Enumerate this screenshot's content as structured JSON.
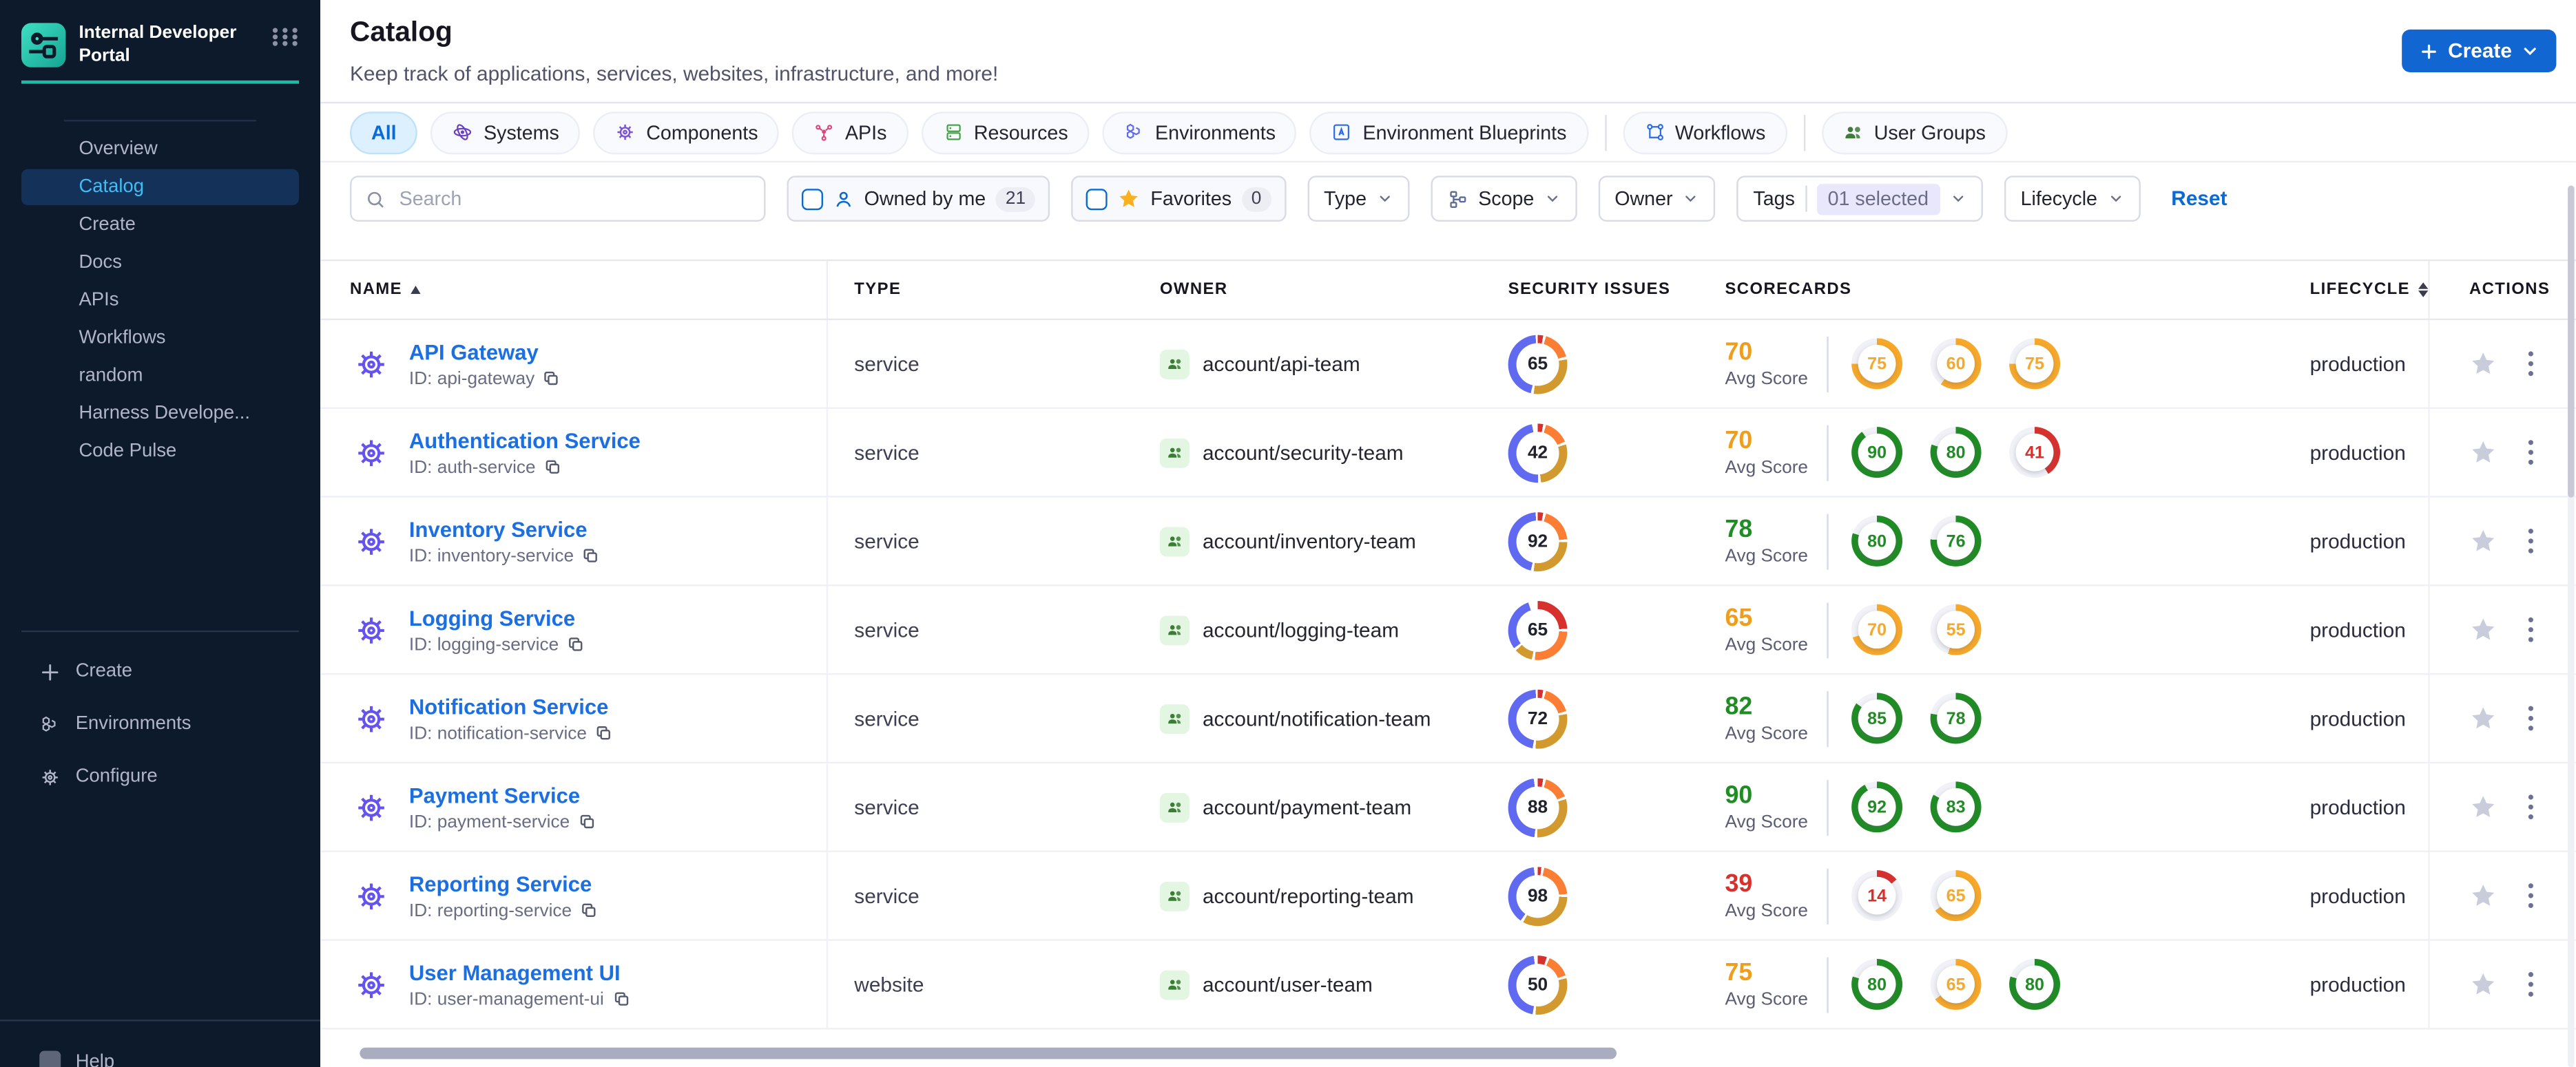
{
  "brand": {
    "title_line1": "Internal Developer",
    "title_line2": "Portal"
  },
  "sidebar": {
    "nav": [
      {
        "label": "Overview",
        "active": false
      },
      {
        "label": "Catalog",
        "active": true
      },
      {
        "label": "Create",
        "active": false
      },
      {
        "label": "Docs",
        "active": false
      },
      {
        "label": "APIs",
        "active": false
      },
      {
        "label": "Workflows",
        "active": false
      },
      {
        "label": "random",
        "active": false
      },
      {
        "label": "Harness Develope...",
        "active": false
      },
      {
        "label": "Code Pulse",
        "active": false
      }
    ],
    "bottom": [
      {
        "label": "Create",
        "icon": "plus"
      },
      {
        "label": "Environments",
        "icon": "hexagons"
      },
      {
        "label": "Configure",
        "icon": "gear"
      }
    ],
    "help_label": "Help"
  },
  "header": {
    "title": "Catalog",
    "subtitle": "Keep track of applications, services, websites, infrastructure, and more!",
    "create_button": "Create"
  },
  "tabs": [
    {
      "label": "All",
      "active": true,
      "icon": "",
      "color": "#0b6ad3",
      "divider_before": false
    },
    {
      "label": "Systems",
      "active": false,
      "icon": "systems",
      "color": "#6b3fc4",
      "divider_before": false
    },
    {
      "label": "Components",
      "active": false,
      "icon": "gear",
      "color": "#7a52d6",
      "divider_before": false
    },
    {
      "label": "APIs",
      "active": false,
      "icon": "apis",
      "color": "#e0447c",
      "divider_before": false
    },
    {
      "label": "Resources",
      "active": false,
      "icon": "resources",
      "color": "#43a047",
      "divider_before": false
    },
    {
      "label": "Environments",
      "active": false,
      "icon": "hexagons",
      "color": "#5f6af0",
      "divider_before": false
    },
    {
      "label": "Environment Blueprints",
      "active": false,
      "icon": "blueprint",
      "color": "#2b6be4",
      "divider_before": false
    },
    {
      "label": "Workflows",
      "active": false,
      "icon": "workflows",
      "color": "#2b6be4",
      "divider_before": true
    },
    {
      "label": "User Groups",
      "active": false,
      "icon": "people",
      "color": "#3e7d3a",
      "divider_before": true
    }
  ],
  "filters": {
    "search_placeholder": "Search",
    "owned_by_me": {
      "label": "Owned by me",
      "count": "21"
    },
    "favorites": {
      "label": "Favorites",
      "count": "0"
    },
    "type_label": "Type",
    "scope_label": "Scope",
    "owner_label": "Owner",
    "tags_label": "Tags",
    "tags_selected": "01 selected",
    "lifecycle_label": "Lifecycle",
    "reset_label": "Reset"
  },
  "table": {
    "columns": {
      "name": "Name",
      "type": "Type",
      "owner": "Owner",
      "security": "Security Issues",
      "scorecards": "Scorecards",
      "lifecycle": "Lifecycle",
      "actions": "Actions"
    },
    "avg_score_label": "Avg Score",
    "rows": [
      {
        "name": "API Gateway",
        "id": "ID: api-gateway",
        "type": "service",
        "owner": "account/api-team",
        "security_issues": "65",
        "donut": [
          [
            "#d7312e",
            3
          ],
          [
            "#fb7e34",
            16
          ],
          [
            "#d1992e",
            30
          ],
          [
            "#5f6af0",
            45
          ]
        ],
        "avg_score": {
          "value": "70",
          "color": "#ee9d1c"
        },
        "scores": [
          {
            "value": "75",
            "color": "#f7a82a"
          },
          {
            "value": "60",
            "color": "#f7a82a"
          },
          {
            "value": "75",
            "color": "#f7a82a"
          }
        ],
        "lifecycle": "production"
      },
      {
        "name": "Authentication Service",
        "id": "ID: auth-service",
        "type": "service",
        "owner": "account/security-team",
        "security_issues": "42",
        "donut": [
          [
            "#d7312e",
            3
          ],
          [
            "#fb7e34",
            14
          ],
          [
            "#d1992e",
            28
          ],
          [
            "#5f6af0",
            47
          ]
        ],
        "avg_score": {
          "value": "70",
          "color": "#ee9d1c"
        },
        "scores": [
          {
            "value": "90",
            "color": "#1f8c24"
          },
          {
            "value": "80",
            "color": "#1f8c24"
          },
          {
            "value": "41",
            "color": "#d7312e"
          }
        ],
        "lifecycle": "production"
      },
      {
        "name": "Inventory Service",
        "id": "ID: inventory-service",
        "type": "service",
        "owner": "account/inventory-team",
        "security_issues": "92",
        "donut": [
          [
            "#d7312e",
            3
          ],
          [
            "#fb7e34",
            19
          ],
          [
            "#d1992e",
            27
          ],
          [
            "#5f6af0",
            45
          ]
        ],
        "avg_score": {
          "value": "78",
          "color": "#1f8c24"
        },
        "scores": [
          {
            "value": "80",
            "color": "#1f8c24"
          },
          {
            "value": "76",
            "color": "#1f8c24"
          }
        ],
        "lifecycle": "production"
      },
      {
        "name": "Logging Service",
        "id": "ID: logging-service",
        "type": "service",
        "owner": "account/logging-team",
        "security_issues": "65",
        "donut": [
          [
            "#d7312e",
            24
          ],
          [
            "#fb7e34",
            26
          ],
          [
            "#d1992e",
            10
          ],
          [
            "#5f6af0",
            30
          ]
        ],
        "avg_score": {
          "value": "65",
          "color": "#ee9d1c"
        },
        "scores": [
          {
            "value": "70",
            "color": "#f7a82a"
          },
          {
            "value": "55",
            "color": "#f7a82a"
          }
        ],
        "lifecycle": "production"
      },
      {
        "name": "Notification Service",
        "id": "ID: notification-service",
        "type": "service",
        "owner": "account/notification-team",
        "security_issues": "72",
        "donut": [
          [
            "#d7312e",
            3
          ],
          [
            "#fb7e34",
            16
          ],
          [
            "#d1992e",
            29
          ],
          [
            "#5f6af0",
            46
          ]
        ],
        "avg_score": {
          "value": "82",
          "color": "#1f8c24"
        },
        "scores": [
          {
            "value": "85",
            "color": "#1f8c24"
          },
          {
            "value": "78",
            "color": "#1f8c24"
          }
        ],
        "lifecycle": "production"
      },
      {
        "name": "Payment Service",
        "id": "ID: payment-service",
        "type": "service",
        "owner": "account/payment-team",
        "security_issues": "88",
        "donut": [
          [
            "#d7312e",
            3
          ],
          [
            "#fb7e34",
            14
          ],
          [
            "#d1992e",
            30
          ],
          [
            "#5f6af0",
            46
          ]
        ],
        "avg_score": {
          "value": "90",
          "color": "#1f8c24"
        },
        "scores": [
          {
            "value": "92",
            "color": "#1f8c24"
          },
          {
            "value": "83",
            "color": "#1f8c24"
          }
        ],
        "lifecycle": "production"
      },
      {
        "name": "Reporting Service",
        "id": "ID: reporting-service",
        "type": "service",
        "owner": "account/reporting-team",
        "security_issues": "98",
        "donut": [
          [
            "#d7312e",
            2
          ],
          [
            "#fb7e34",
            20
          ],
          [
            "#d1992e",
            33
          ],
          [
            "#5f6af0",
            38
          ]
        ],
        "avg_score": {
          "value": "39",
          "color": "#d7312e"
        },
        "scores": [
          {
            "value": "14",
            "color": "#d7312e"
          },
          {
            "value": "65",
            "color": "#f7a82a"
          }
        ],
        "lifecycle": "production"
      },
      {
        "name": "User Management UI",
        "id": "ID: user-management-ui",
        "type": "website",
        "owner": "account/user-team",
        "security_issues": "50",
        "donut": [
          [
            "#d7312e",
            5
          ],
          [
            "#fb7e34",
            13
          ],
          [
            "#d1992e",
            30
          ],
          [
            "#5f6af0",
            45
          ]
        ],
        "avg_score": {
          "value": "75",
          "color": "#ee9d1c"
        },
        "scores": [
          {
            "value": "80",
            "color": "#1f8c24"
          },
          {
            "value": "65",
            "color": "#f7a82a"
          },
          {
            "value": "80",
            "color": "#1f8c24"
          }
        ],
        "lifecycle": "production"
      }
    ]
  }
}
